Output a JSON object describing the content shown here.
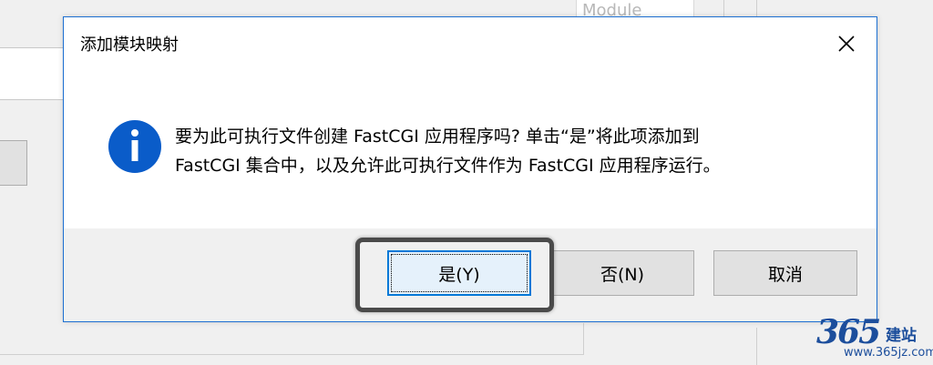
{
  "background": {
    "column_header": "Module"
  },
  "dialog": {
    "title": "添加模块映射",
    "icon": "info-icon",
    "message_line1": "要为此可执行文件创建 FastCGI 应用程序吗? 单击“是”将此项添加到",
    "message_line2": "FastCGI 集合中，以及允许此可执行文件作为 FastCGI 应用程序运行。",
    "buttons": {
      "yes": "是(Y)",
      "no": "否(N)",
      "cancel": "取消"
    }
  },
  "watermark": {
    "logo": "365",
    "name": "建站",
    "url": "www.365jz.com"
  },
  "colors": {
    "accent": "#0078d7",
    "dialog_border": "#1c6fd1",
    "icon_blue": "#0a5cc9",
    "highlight": "#4a4a4a"
  }
}
